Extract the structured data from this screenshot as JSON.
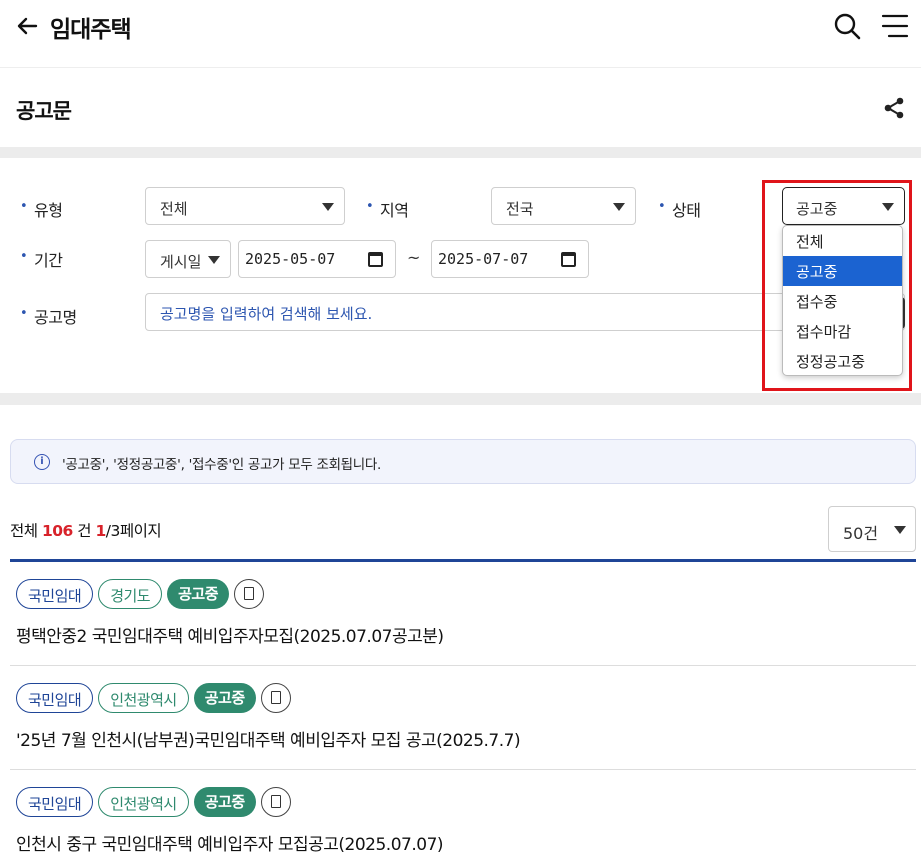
{
  "header": {
    "title": "임대주택"
  },
  "section": {
    "title": "공고문"
  },
  "filters": {
    "type": {
      "label": "유형",
      "value": "전체"
    },
    "region": {
      "label": "지역",
      "value": "전국"
    },
    "status": {
      "label": "상태",
      "value": "공고중",
      "options": [
        "전체",
        "공고중",
        "접수중",
        "접수마감",
        "정정공고중"
      ],
      "selected_index": 1
    },
    "period": {
      "label": "기간",
      "basis": "게시일",
      "from": "2025-05-07",
      "separator": "~",
      "to": "2025-07-07"
    },
    "name": {
      "label": "공고명",
      "placeholder": "공고명을 입력하여 검색해 보세요."
    }
  },
  "info": {
    "text": "'공고중', '정정공고중', '접수중'인 공고가 모두 조회됩니다."
  },
  "summary": {
    "prefix": "전체",
    "total": "106",
    "unit": "건",
    "page": "1",
    "page_suffix": "/3페이지",
    "page_size": "50건"
  },
  "colors": {
    "accent_blue": "#1f4597",
    "status_green": "#2f8a6e",
    "highlight_red": "#e0141a",
    "selected_option": "#1b63d1"
  },
  "listings": [
    {
      "type": "국민임대",
      "region": "경기도",
      "status": "공고중",
      "title": "평택안중2 국민임대주택 예비입주자모집(2025.07.07공고분)"
    },
    {
      "type": "국민임대",
      "region": "인천광역시",
      "status": "공고중",
      "title": "'25년 7월 인천시(남부권)국민임대주택 예비입주자 모집 공고(2025.7.7)"
    },
    {
      "type": "국민임대",
      "region": "인천광역시",
      "status": "공고중",
      "title": "인천시 중구 국민임대주택 예비입주자 모집공고(2025.07.07)"
    }
  ]
}
